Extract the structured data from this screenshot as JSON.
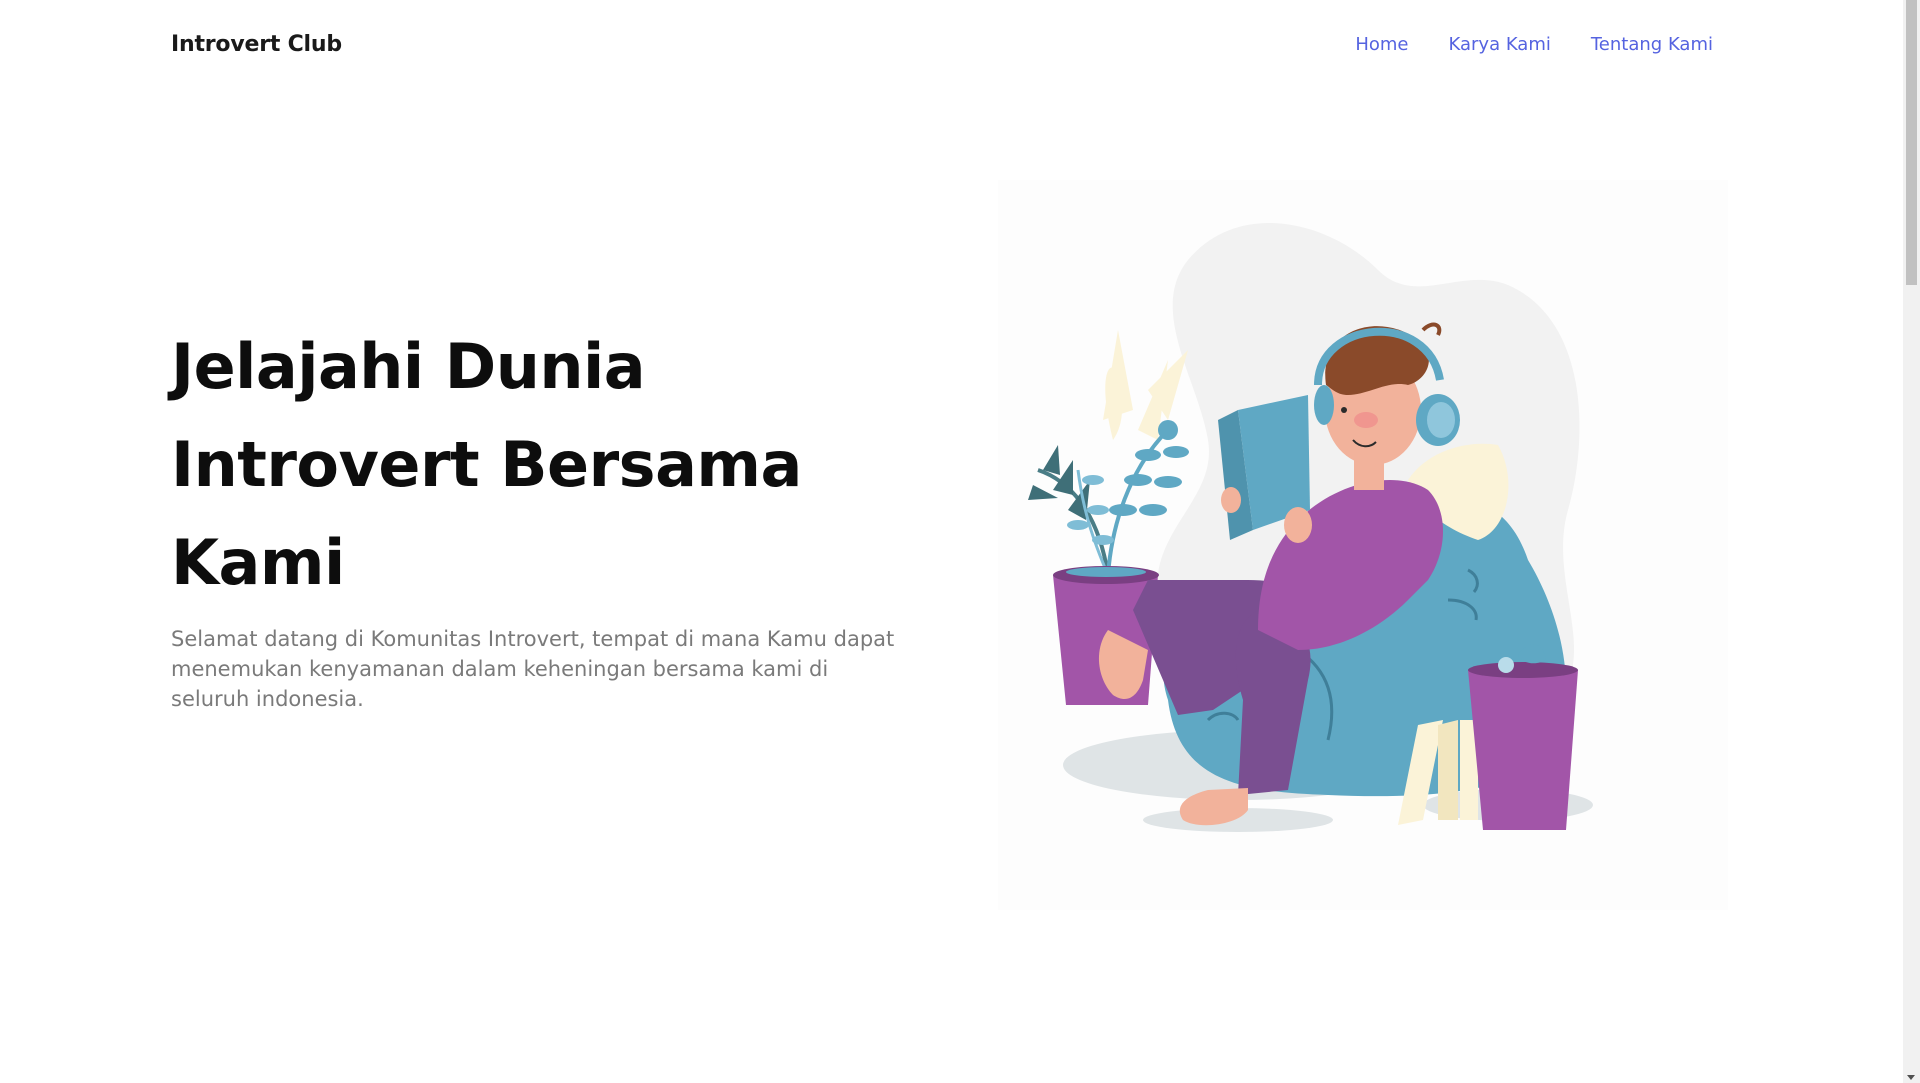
{
  "navbar": {
    "brand": "Introvert Club",
    "links": [
      {
        "label": "Home"
      },
      {
        "label": "Karya Kami"
      },
      {
        "label": "Tentang Kami"
      }
    ]
  },
  "hero": {
    "title_lines": [
      "Jelajahi Dunia",
      "Introvert Bersama",
      "Kami"
    ],
    "description": "Selamat datang di Komunitas Introvert, tempat di mana Kamu dapat menemukan kenyamanan dalam keheningan bersama kami di seluruh indonesia."
  },
  "colors": {
    "nav_link": "#5563e0",
    "title": "#0d0d0d",
    "description": "#7a7a7a",
    "beanbag": "#5fa8c4",
    "pajama": "#a255a8",
    "hair": "#8a4a2a"
  },
  "icons": {
    "scroll_down": "chevron-down-icon"
  }
}
